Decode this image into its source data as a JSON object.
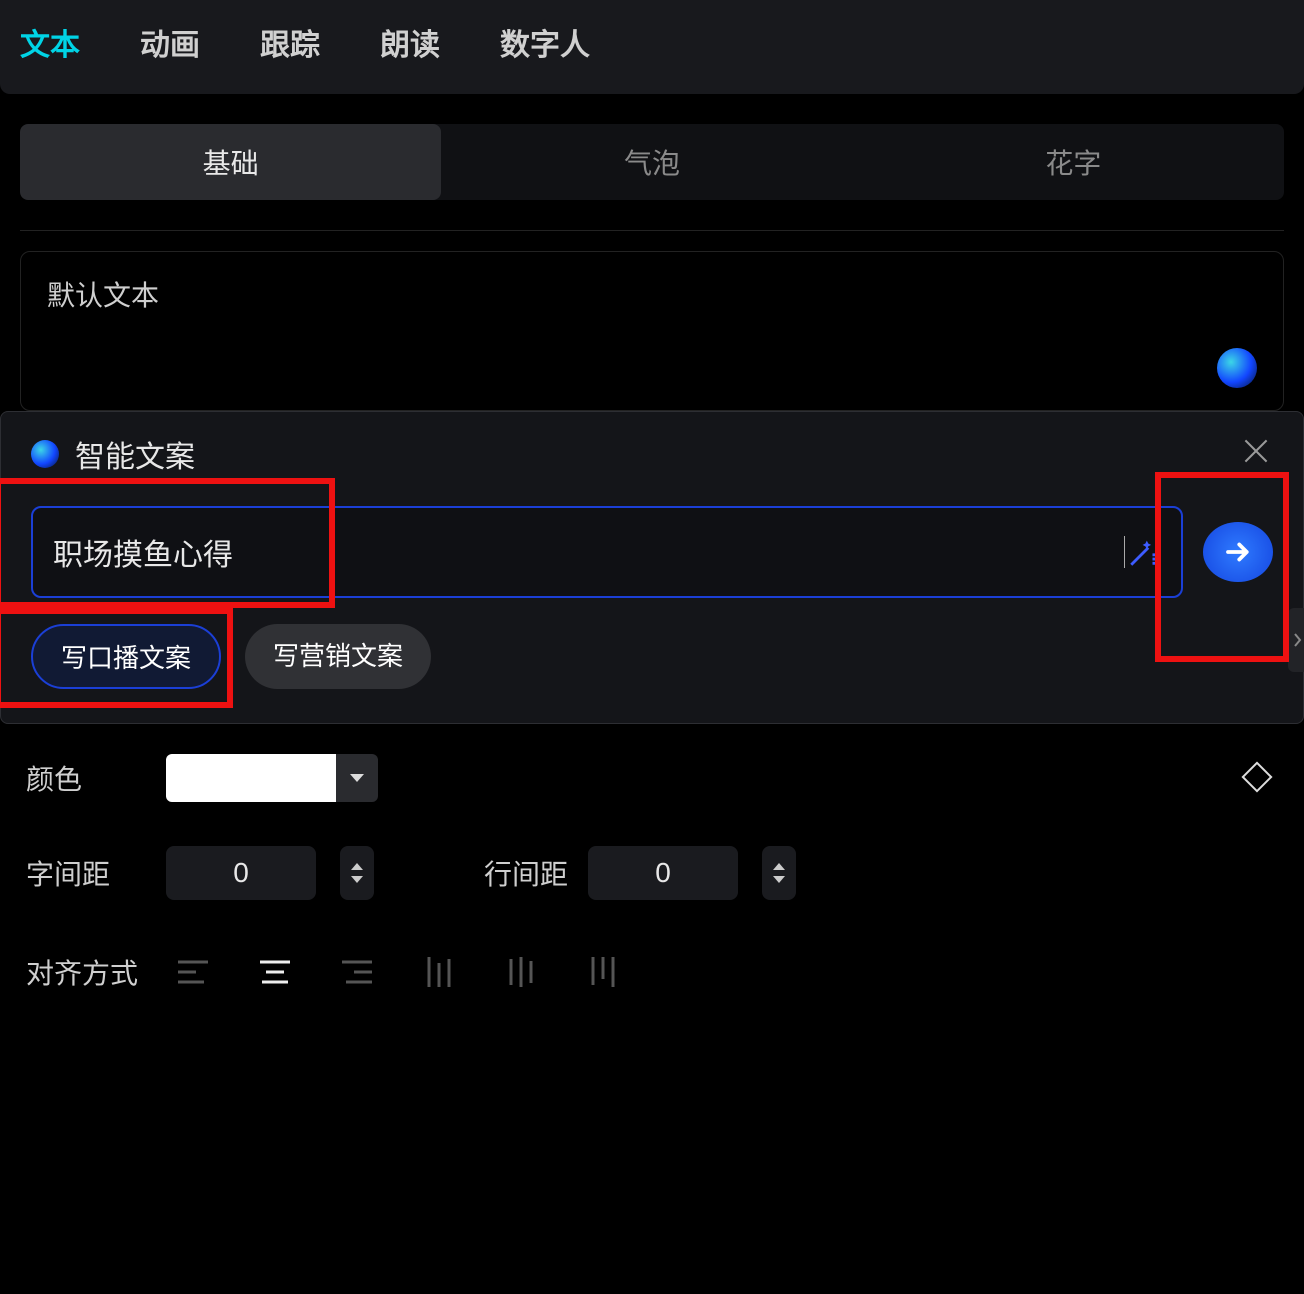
{
  "top_tabs": {
    "text": "文本",
    "animation": "动画",
    "track": "跟踪",
    "read": "朗读",
    "avatar": "数字人",
    "active": "text"
  },
  "sub_tabs": {
    "basic": "基础",
    "bubble": "气泡",
    "fancy": "花字",
    "active": "basic"
  },
  "default_text_label": "默认文本",
  "smart_panel": {
    "title": "智能文案",
    "input_value": "职场摸鱼心得",
    "chips": {
      "broadcast": "写口播文案",
      "marketing": "写营销文案",
      "active": "broadcast"
    }
  },
  "color_row": {
    "label": "颜色",
    "value": "#ffffff"
  },
  "spacing_row": {
    "char_label": "字间距",
    "char_value": "0",
    "line_label": "行间距",
    "line_value": "0"
  },
  "align_row": {
    "label": "对齐方式",
    "active": "center"
  }
}
